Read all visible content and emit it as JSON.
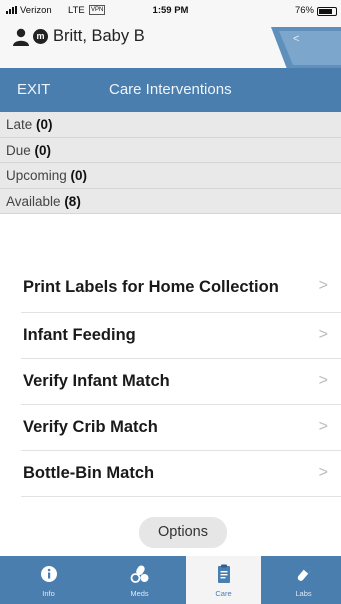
{
  "status_bar": {
    "carrier": "Verizon",
    "network": "LTE",
    "vpn": "VPN",
    "time": "1:59 PM",
    "battery": "76%"
  },
  "patient": {
    "badge": "m",
    "name": "Britt, Baby B"
  },
  "nav": {
    "exit_label": "EXIT",
    "title": "Care Interventions"
  },
  "categories": [
    {
      "label": "Late",
      "count": "(0)"
    },
    {
      "label": "Due",
      "count": "(0)"
    },
    {
      "label": "Upcoming",
      "count": "(0)"
    },
    {
      "label": "Available",
      "count": "(8)"
    }
  ],
  "interventions": [
    {
      "label": "Print Labels for Home Collection",
      "chevron": ">"
    },
    {
      "label": "Infant Feeding",
      "chevron": ">"
    },
    {
      "label": "Verify Infant Match",
      "chevron": ">"
    },
    {
      "label": "Verify Crib Match",
      "chevron": ">"
    },
    {
      "label": "Bottle-Bin Match",
      "chevron": ">"
    }
  ],
  "options_label": "Options",
  "tabs": [
    {
      "label": "Info",
      "icon": "info-icon"
    },
    {
      "label": "Meds",
      "icon": "meds-icon"
    },
    {
      "label": "Care",
      "icon": "care-clipboard-icon",
      "active": true
    },
    {
      "label": "Labs",
      "icon": "labs-icon"
    }
  ],
  "colors": {
    "accent": "#4a7eae",
    "category_bg": "#e9e9e9"
  }
}
